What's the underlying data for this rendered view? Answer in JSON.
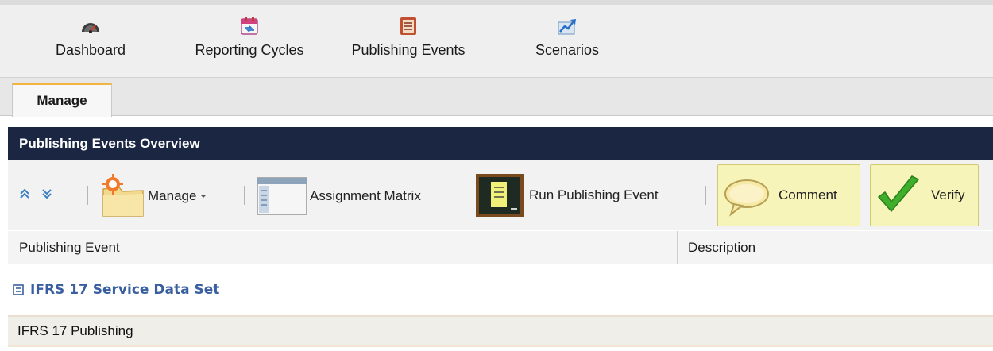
{
  "nav": {
    "items": [
      {
        "label": "Dashboard",
        "icon": "speedometer-icon"
      },
      {
        "label": "Reporting Cycles",
        "icon": "calendar-icon"
      },
      {
        "label": "Publishing Events",
        "icon": "event-list-icon"
      },
      {
        "label": "Scenarios",
        "icon": "chart-arrow-icon"
      }
    ]
  },
  "tabs": [
    {
      "label": "Manage",
      "active": true
    }
  ],
  "panel": {
    "title": "Publishing Events Overview"
  },
  "toolbar": {
    "manage_label": "Manage",
    "assignment_label": "Assignment Matrix",
    "run_label": "Run Publishing Event",
    "comment_label": "Comment",
    "verify_label": "Verify"
  },
  "grid": {
    "columns": [
      "Publishing Event",
      "Description"
    ],
    "group": {
      "label": "IFRS 17 Service Data Set",
      "expanded": true
    },
    "rows": [
      {
        "name": "IFRS 17 Publishing",
        "description": ""
      }
    ]
  },
  "colors": {
    "header_bg": "#1b2643",
    "tab_accent": "#f2b340",
    "group_text": "#3a5fa0",
    "highlight_bg": "#f7f4b9",
    "verify_green": "#3fae2a"
  }
}
